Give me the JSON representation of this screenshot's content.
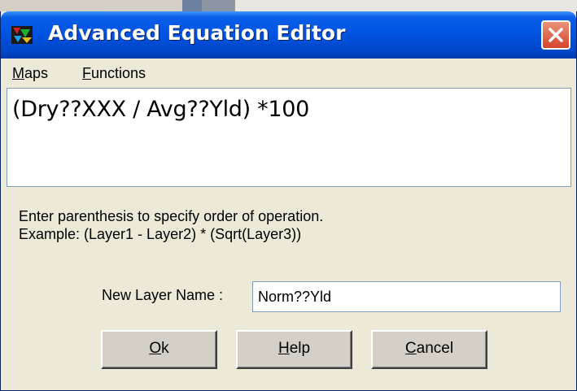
{
  "window": {
    "title": "Advanced Equation Editor"
  },
  "menu": {
    "items": [
      {
        "first": "M",
        "rest": "aps"
      },
      {
        "first": "F",
        "rest": "unctions"
      }
    ]
  },
  "equation": {
    "text": "(Dry??XXX / Avg??Yld) *100"
  },
  "hint": {
    "line1": "Enter parenthesis to specify order of operation.",
    "line2": "Example: (Layer1 - Layer2) * (Sqrt(Layer3))"
  },
  "layer_name": {
    "label": "New Layer Name :",
    "value": "Norm??Yld"
  },
  "buttons": [
    {
      "first": "O",
      "rest": "k"
    },
    {
      "first": "H",
      "rest": "elp"
    },
    {
      "first": "C",
      "rest": "ancel"
    }
  ],
  "colors": {
    "titlebar": "#0054e3",
    "close_button": "#d5432a",
    "dialog_background": "#ece9d8"
  }
}
